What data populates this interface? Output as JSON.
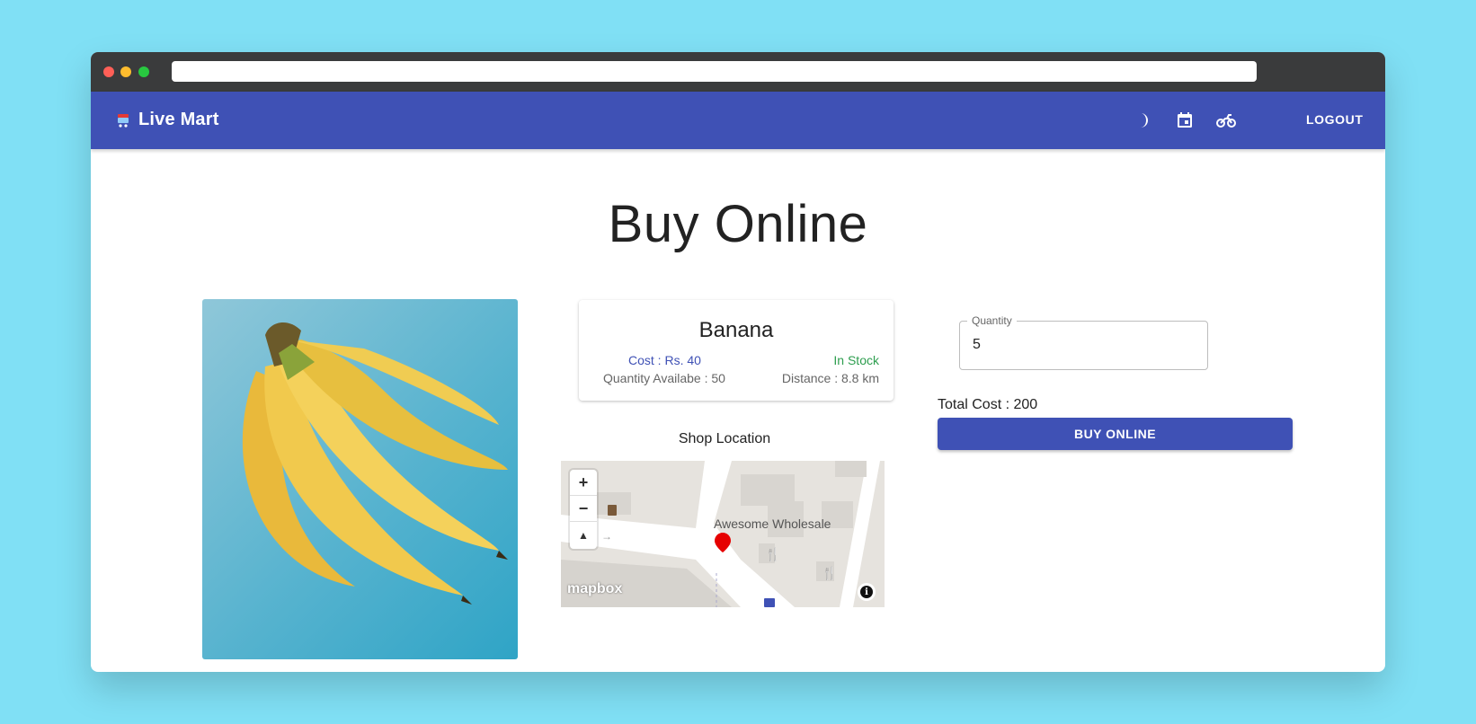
{
  "app": {
    "brand": "Live Mart",
    "logout_label": "LOGOUT",
    "accent_color": "#3f51b5",
    "icons": [
      "moon-icon",
      "calendar-icon",
      "motorbike-icon"
    ]
  },
  "page": {
    "title": "Buy Online"
  },
  "product": {
    "name": "Banana",
    "cost": "Cost : Rs. 40",
    "stock_status": "In Stock",
    "quantity_available": "Quantity Availabe : 50",
    "distance": "Distance : 8.8 km"
  },
  "map": {
    "heading": "Shop Location",
    "shop_label": "Awesome Wholesale",
    "attribution_logo": "mapbox",
    "zoom_in": "+",
    "zoom_out": "−",
    "compass": "▲",
    "info": "i"
  },
  "order": {
    "quantity_label": "Quantity",
    "quantity_value": "5",
    "total_cost": "Total Cost : 200",
    "buy_label": "BUY ONLINE"
  }
}
